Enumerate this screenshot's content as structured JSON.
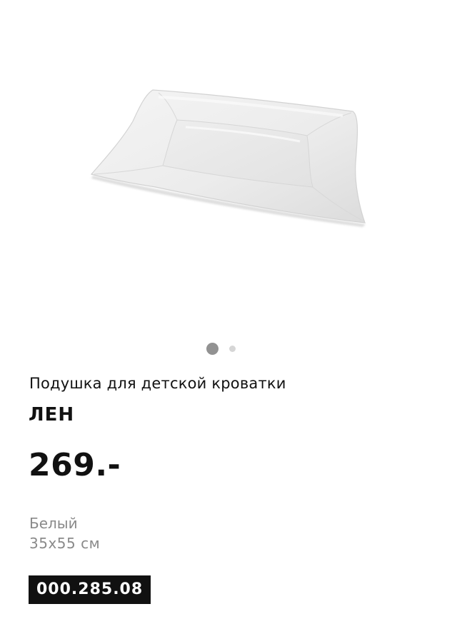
{
  "product": {
    "image_icon": "pillow-product-image",
    "carousel": {
      "total": 2,
      "active_index": 0
    },
    "type": "Подушка для детской кроватки",
    "name": "ЛЕН",
    "price": "269.-",
    "color": "Белый",
    "size": "35x55 см",
    "article_number": "000.285.08"
  },
  "colors": {
    "text": "#111111",
    "muted_text": "#8a8a8a",
    "dot_active": "#929292",
    "dot_inactive": "#d6d6d6",
    "article_bg": "#111111",
    "article_text": "#ffffff"
  }
}
